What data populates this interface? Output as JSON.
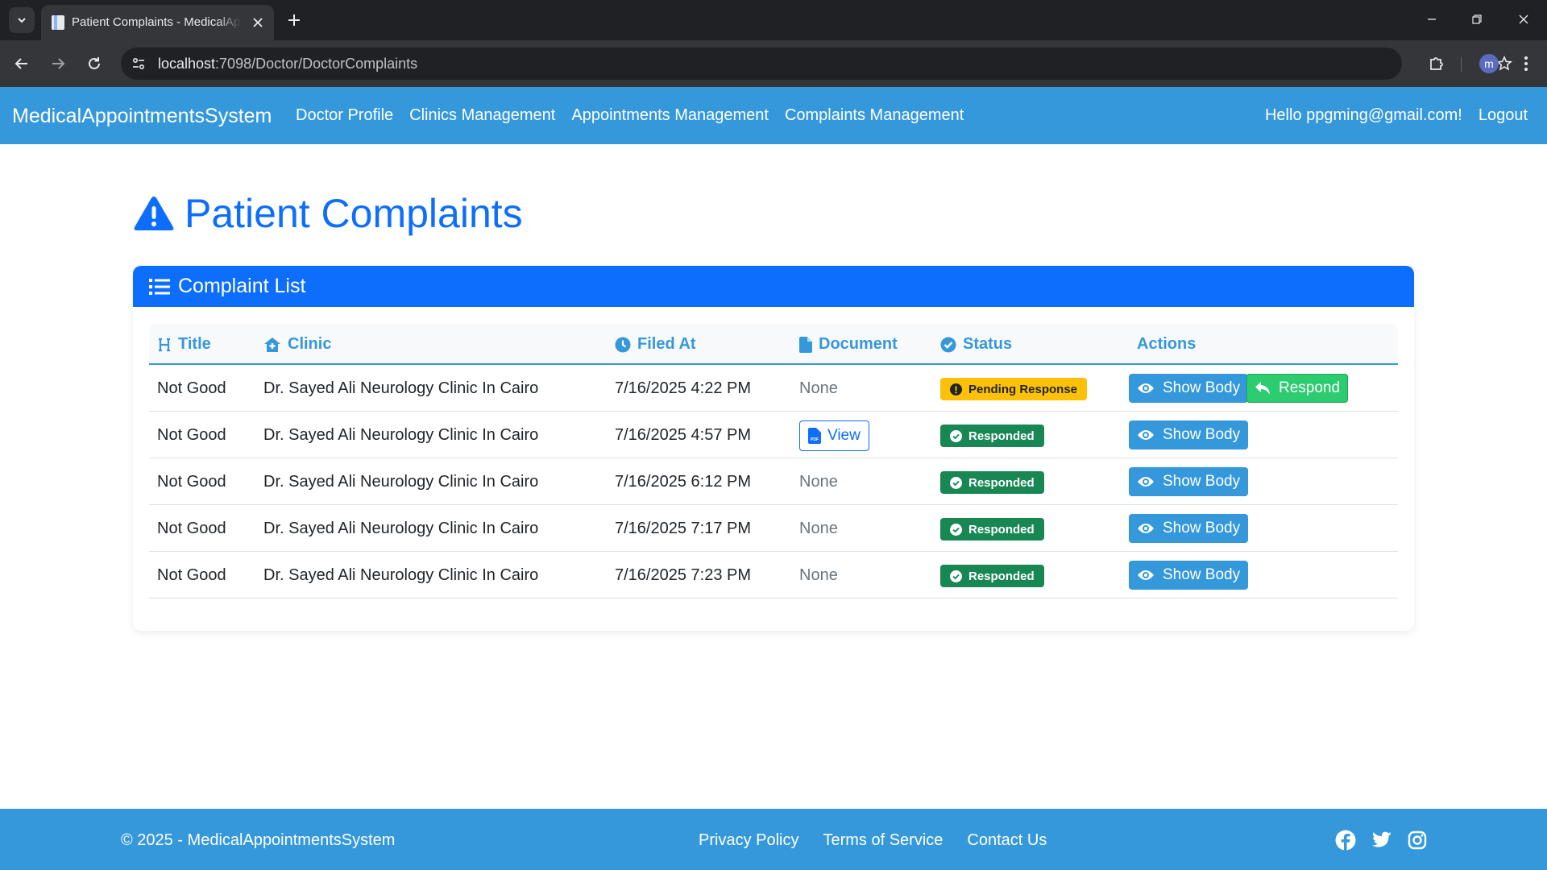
{
  "browser": {
    "tab_title": "Patient Complaints - MedicalAppointmentsSystem",
    "url_host": "localhost",
    "url_path": ":7098/Doctor/DoctorComplaints",
    "profile_initial": "m"
  },
  "navbar": {
    "brand": "MedicalAppointmentsSystem",
    "links": [
      "Doctor Profile",
      "Clinics Management",
      "Appointments Management",
      "Complaints Management"
    ],
    "greeting": "Hello ppgming@gmail.com!",
    "logout": "Logout"
  },
  "page": {
    "title": "Patient Complaints",
    "card_title": "Complaint List"
  },
  "table": {
    "headers": {
      "title": "Title",
      "clinic": "Clinic",
      "filed_at": "Filed At",
      "document": "Document",
      "status": "Status",
      "actions": "Actions"
    },
    "rows": [
      {
        "title": "Not Good",
        "clinic": "Dr. Sayed Ali Neurology Clinic In Cairo",
        "filed_at": "7/16/2025 4:22 PM",
        "document": "None",
        "status": "Pending Response",
        "show": "Show Body",
        "respond": "Respond"
      },
      {
        "title": "Not Good",
        "clinic": "Dr. Sayed Ali Neurology Clinic In Cairo",
        "filed_at": "7/16/2025 4:57 PM",
        "document": "View",
        "status": "Responded",
        "show": "Show Body"
      },
      {
        "title": "Not Good",
        "clinic": "Dr. Sayed Ali Neurology Clinic In Cairo",
        "filed_at": "7/16/2025 6:12 PM",
        "document": "None",
        "status": "Responded",
        "show": "Show Body"
      },
      {
        "title": "Not Good",
        "clinic": "Dr. Sayed Ali Neurology Clinic In Cairo",
        "filed_at": "7/16/2025 7:17 PM",
        "document": "None",
        "status": "Responded",
        "show": "Show Body"
      },
      {
        "title": "Not Good",
        "clinic": "Dr. Sayed Ali Neurology Clinic In Cairo",
        "filed_at": "7/16/2025 7:23 PM",
        "document": "None",
        "status": "Responded",
        "show": "Show Body"
      }
    ]
  },
  "footer": {
    "copyright": "© 2025 - MedicalAppointmentsSystem",
    "links": [
      "Privacy Policy",
      "Terms of Service",
      "Contact Us"
    ],
    "social_icons": [
      "facebook-icon",
      "twitter-icon",
      "instagram-icon"
    ]
  },
  "colors": {
    "navbar": "#3498db",
    "primary": "#0d6efd",
    "pending": "#ffc107",
    "responded": "#198754",
    "respond_button": "#2ecc71"
  }
}
